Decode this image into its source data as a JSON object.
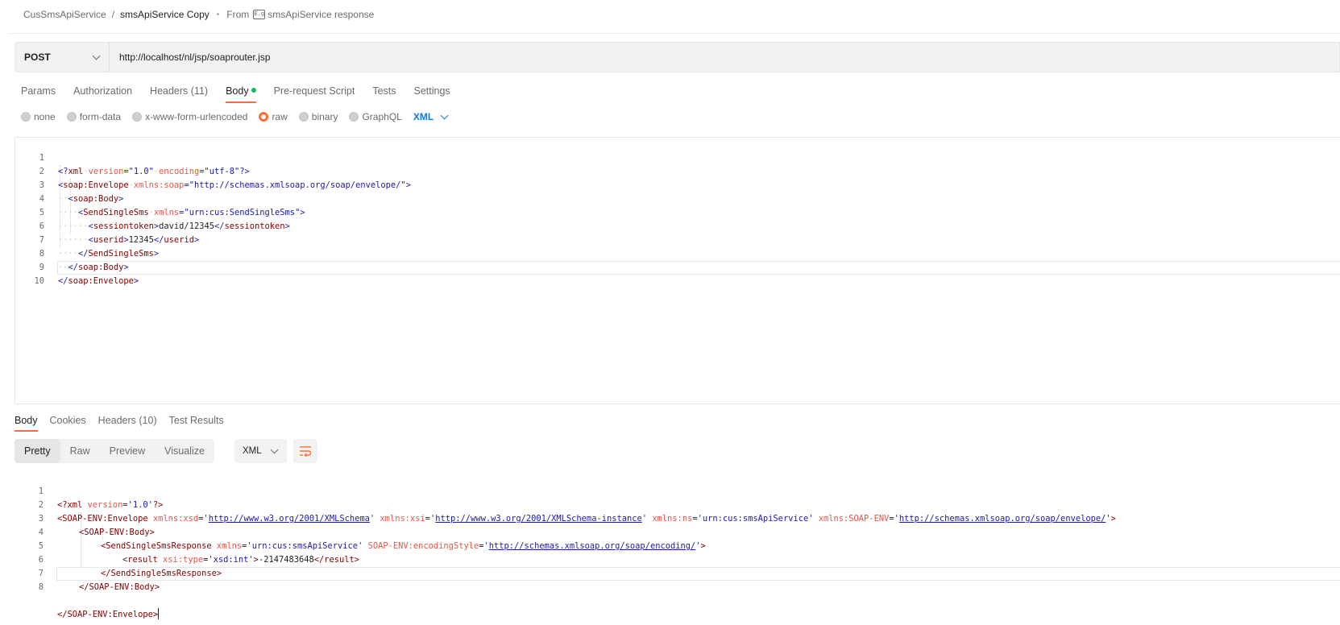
{
  "breadcrumb": {
    "collection": "CusSmsApiService",
    "separator": "/",
    "request": "smsApiService Copy",
    "bullet": "•",
    "from_label": "From",
    "icon_glyph": "E.g",
    "source": "smsApiService response"
  },
  "request": {
    "method": "POST",
    "url": "http://localhost/nl/jsp/soaprouter.jsp"
  },
  "request_tabs": [
    {
      "label": "Params"
    },
    {
      "label": "Authorization"
    },
    {
      "label": "Headers (11)"
    },
    {
      "label": "Body"
    },
    {
      "label": "Pre-request Script"
    },
    {
      "label": "Tests"
    },
    {
      "label": "Settings"
    }
  ],
  "body_types": [
    {
      "label": "none"
    },
    {
      "label": "form-data"
    },
    {
      "label": "x-www-form-urlencoded"
    },
    {
      "label": "raw"
    },
    {
      "label": "binary"
    },
    {
      "label": "GraphQL"
    }
  ],
  "body_format": "XML",
  "editor": {
    "line_numbers": [
      "1",
      "2",
      "3",
      "4",
      "5",
      "6",
      "7",
      "8",
      "9",
      "10"
    ],
    "line1": {
      "open": "<?",
      "tag": "xml",
      "ws1": "·",
      "attr1": "version",
      "eq1": "=",
      "val1": "\"1.0\"",
      "ws2": "·",
      "attr2": "encoding",
      "eq2": "=",
      "val2": "\"utf-8\"",
      "close": "?>"
    },
    "line2": {
      "open": "<",
      "tag": "soap:Envelope",
      "ws": "·",
      "attr": "xmlns:soap",
      "eq": "=",
      "val": "\"http://schemas.xmlsoap.org/soap/envelope/\"",
      "close": ">"
    },
    "line3": {
      "ws": "··",
      "open": "<",
      "tag": "soap:Body",
      "close": ">"
    },
    "line4": {
      "ws": "····",
      "open": "<",
      "tag": "SendSingleSms",
      "ws2": "·",
      "attr": "xmlns",
      "eq": "=",
      "val": "\"urn:cus:SendSingleSms\"",
      "close": ">"
    },
    "line5": {
      "ws": "······",
      "open": "<",
      "tag": "sessiontoken",
      "close": ">",
      "text": "david/12345",
      "end_open": "</",
      "end_tag": "sessiontoken",
      "end_close": ">"
    },
    "line6": {
      "ws": "······",
      "open": "<",
      "tag": "userid",
      "close": ">",
      "text": "12345",
      "end_open": "</",
      "end_tag": "userid",
      "end_close": ">"
    },
    "line7": {
      "ws": "····",
      "open": "</",
      "tag": "SendSingleSms",
      "close": ">"
    },
    "line8": {
      "ws": "··",
      "open": "</",
      "tag": "soap:Body",
      "close": ">"
    },
    "line9": {
      "open": "</",
      "tag": "soap:Envelope",
      "close": ">"
    }
  },
  "response_tabs": [
    {
      "label": "Body"
    },
    {
      "label": "Cookies"
    },
    {
      "label": "Headers (10)"
    },
    {
      "label": "Test Results"
    }
  ],
  "view_modes": [
    {
      "label": "Pretty"
    },
    {
      "label": "Raw"
    },
    {
      "label": "Preview"
    },
    {
      "label": "Visualize"
    }
  ],
  "response_format": "XML",
  "response": {
    "line_numbers": [
      "1",
      "2",
      "3",
      "4",
      "5",
      "6",
      "7",
      "8"
    ],
    "line1": {
      "open": "<?xml ",
      "attr": "version",
      "eq": "=",
      "val": "'1.0'",
      "close": "?>"
    },
    "line2": {
      "open": "<SOAP-ENV:Envelope ",
      "a1": "xmlns:xsd",
      "v1": "http://www.w3.org/2001/XMLSchema",
      "a2": "xmlns:xsi",
      "v2": "http://www.w3.org/2001/XMLSchema-instance",
      "a3": "xmlns:ns",
      "v3": "'urn:cus:smsApiService'",
      "a4": "xmlns:SOAP-ENV",
      "v4": "http://schemas.xmlsoap.org/soap/envelope/",
      "close": ">"
    },
    "line3": {
      "tag": "<SOAP-ENV:Body>"
    },
    "line4": {
      "open": "<SendSingleSmsResponse ",
      "a1": "xmlns",
      "v1": "'urn:cus:smsApiService'",
      "a2": "SOAP-ENV:encodingStyle",
      "v2": "http://schemas.xmlsoap.org/soap/encoding/",
      "close": ">"
    },
    "line5": {
      "open": "<result ",
      "attr": "xsi:type",
      "eq": "=",
      "val": "'xsd:int'",
      "close": ">",
      "text": "-2147483648",
      "end": "</result>"
    },
    "line6": {
      "tag": "</SendSingleSmsResponse>"
    },
    "line7": {
      "tag": "</SOAP-ENV:Body>"
    },
    "line8": {
      "tag": "</SOAP-ENV:Envelope>"
    }
  },
  "colors": {
    "accent": "#ff6c37",
    "link": "#097bed",
    "success_dot": "#0cbb52"
  }
}
